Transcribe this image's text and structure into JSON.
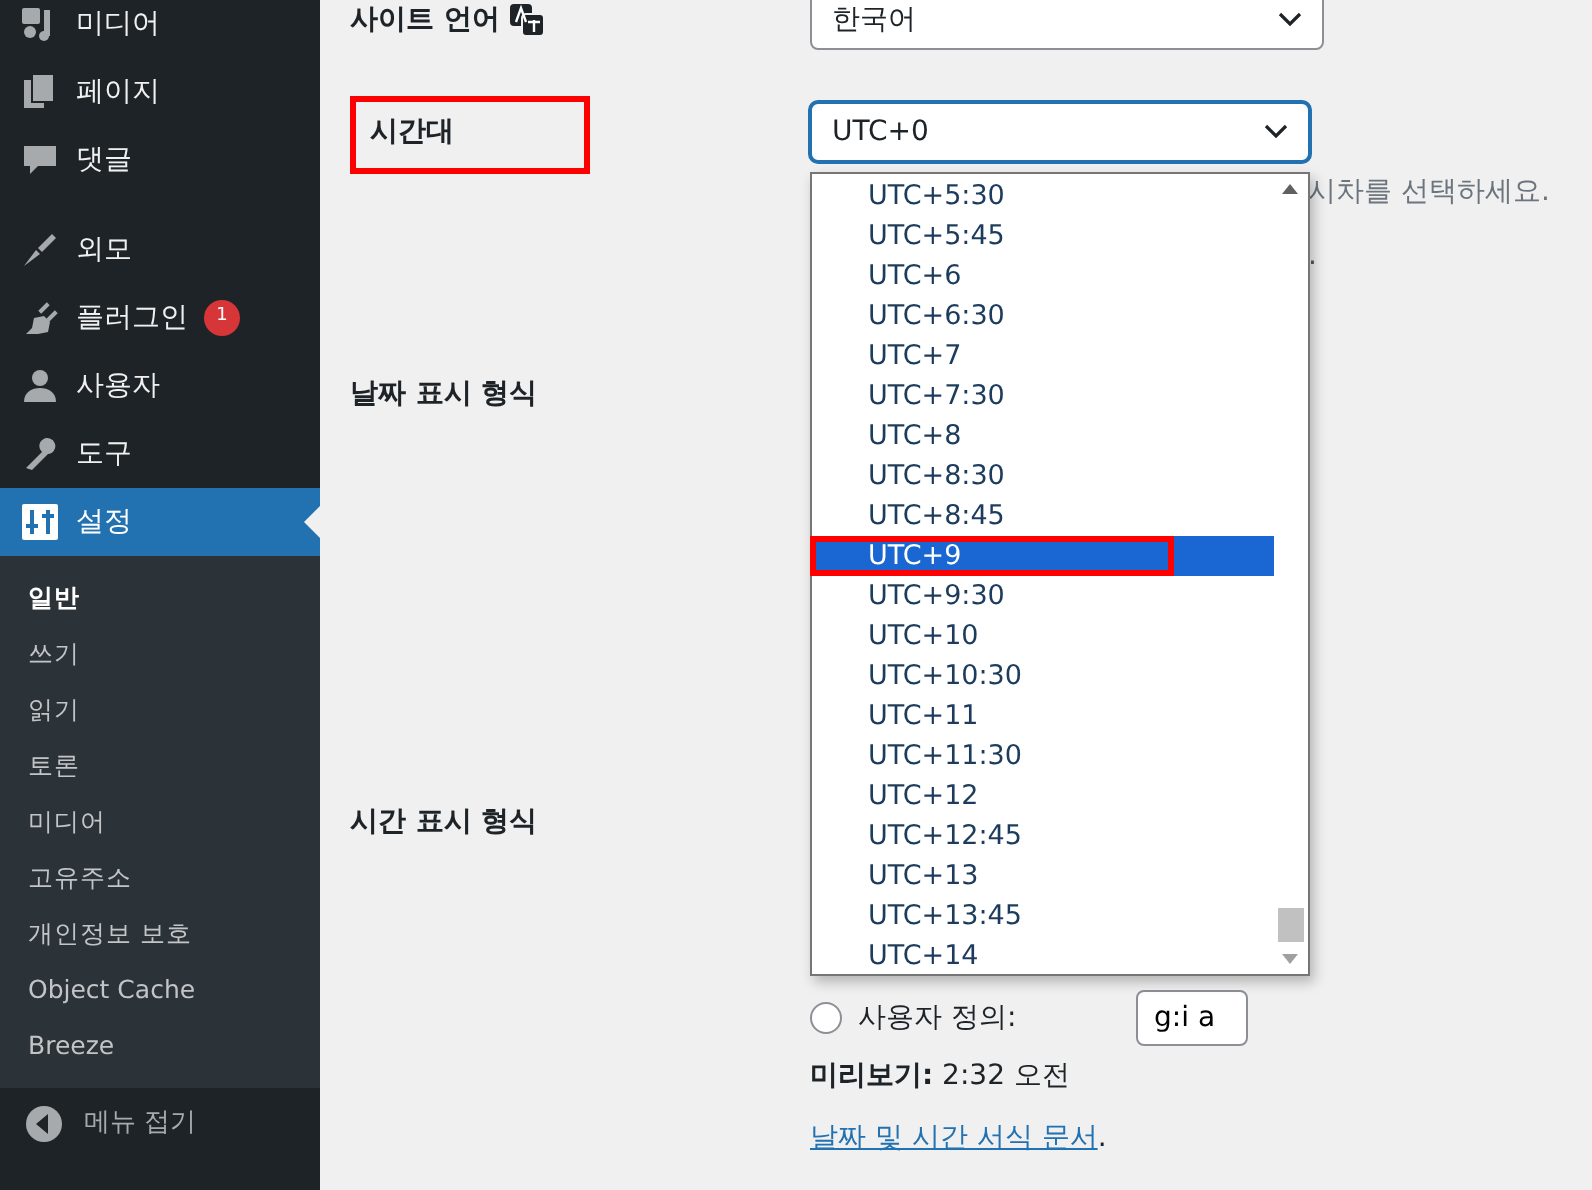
{
  "sidebar": {
    "menu_groups": [
      [
        {
          "label": "미디어",
          "selected": false
        },
        {
          "label": "페이지",
          "selected": false
        },
        {
          "label": "댓글",
          "selected": false
        }
      ],
      [
        {
          "label": "외모",
          "selected": false
        },
        {
          "label": "플러그인",
          "selected": false,
          "badge": "1"
        },
        {
          "label": "사용자",
          "selected": false
        },
        {
          "label": "도구",
          "selected": false
        },
        {
          "label": "설정",
          "selected": true
        }
      ]
    ],
    "submenu": [
      {
        "label": "일반",
        "selected": true
      },
      {
        "label": "쓰기",
        "selected": false
      },
      {
        "label": "읽기",
        "selected": false
      },
      {
        "label": "토론",
        "selected": false
      },
      {
        "label": "미디어",
        "selected": false
      },
      {
        "label": "고유주소",
        "selected": false
      },
      {
        "label": "개인정보 보호",
        "selected": false
      },
      {
        "label": "Object Cache",
        "selected": false
      },
      {
        "label": "Breeze",
        "selected": false
      }
    ],
    "collapse_label": "메뉴 접기"
  },
  "settings": {
    "site_language": {
      "label": "사이트 언어",
      "value": "한국어"
    },
    "timezone": {
      "label": "시간대",
      "annotated": true,
      "value": "UTC+0",
      "hint": "시차를 선택하세요.",
      "hint_2": "."
    },
    "date_format": {
      "label": "날짜 표시 형식"
    },
    "time_format": {
      "label": "시간 표시 형식",
      "custom_label": "사용자 정의:",
      "custom_checked": false,
      "custom_value": "g:i a"
    },
    "preview": "**미리보기:** 2:32 오전",
    "docs_link": "날짜 및 시간 서식 문서",
    "docs_after": "."
  },
  "dropdown": {
    "options": [
      {
        "label": "UTC+5:30",
        "selected": false,
        "annotated": false
      },
      {
        "label": "UTC+5:45",
        "selected": false,
        "annotated": false
      },
      {
        "label": "UTC+6",
        "selected": false,
        "annotated": false
      },
      {
        "label": "UTC+6:30",
        "selected": false,
        "annotated": false
      },
      {
        "label": "UTC+7",
        "selected": false,
        "annotated": false
      },
      {
        "label": "UTC+7:30",
        "selected": false,
        "annotated": false
      },
      {
        "label": "UTC+8",
        "selected": false,
        "annotated": false
      },
      {
        "label": "UTC+8:30",
        "selected": false,
        "annotated": false
      },
      {
        "label": "UTC+8:45",
        "selected": false,
        "annotated": false
      },
      {
        "label": "UTC+9",
        "selected": true,
        "annotated": true
      },
      {
        "label": "UTC+9:30",
        "selected": false,
        "annotated": false
      },
      {
        "label": "UTC+10",
        "selected": false,
        "annotated": false
      },
      {
        "label": "UTC+10:30",
        "selected": false,
        "annotated": false
      },
      {
        "label": "UTC+11",
        "selected": false,
        "annotated": false
      },
      {
        "label": "UTC+11:30",
        "selected": false,
        "annotated": false
      },
      {
        "label": "UTC+12",
        "selected": false,
        "annotated": false
      },
      {
        "label": "UTC+12:45",
        "selected": false,
        "annotated": false
      },
      {
        "label": "UTC+13",
        "selected": false,
        "annotated": false
      },
      {
        "label": "UTC+13:45",
        "selected": false,
        "annotated": false
      },
      {
        "label": "UTC+14",
        "selected": false,
        "annotated": false
      }
    ]
  }
}
